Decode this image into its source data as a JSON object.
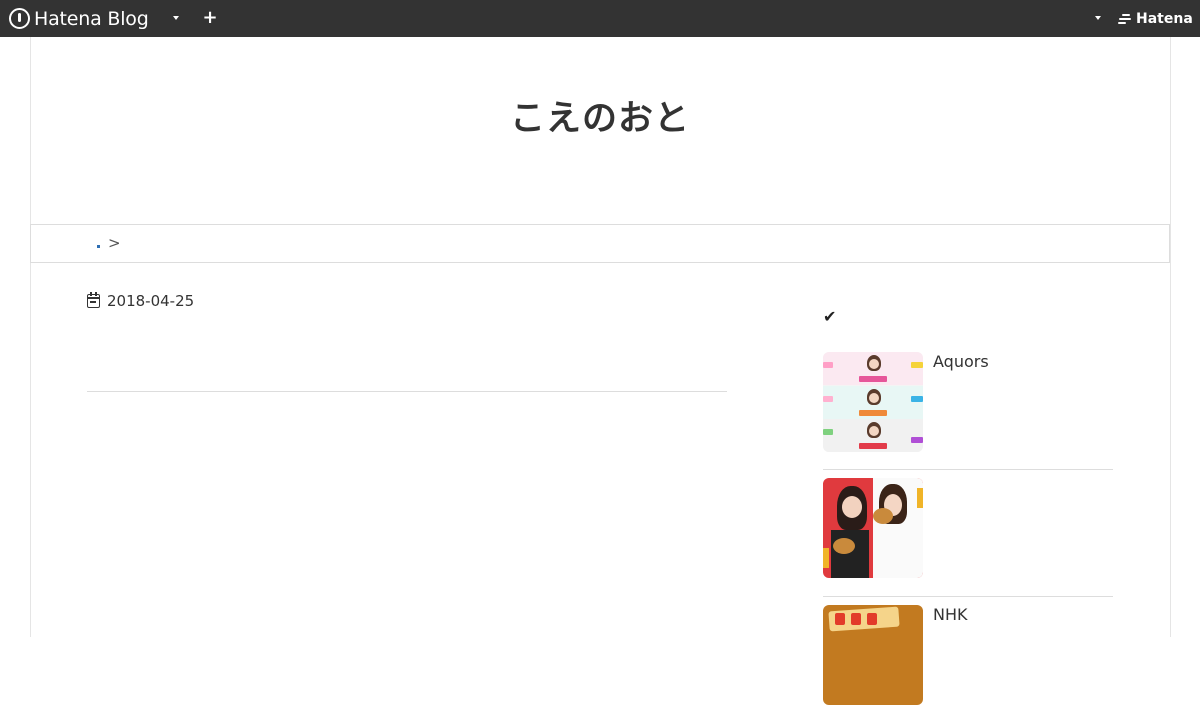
{
  "topbar": {
    "brand": "Hatena Blog",
    "right_brand": "Hatena"
  },
  "blog": {
    "title": "こえのおと"
  },
  "breadcrumb": {
    "separator": ">"
  },
  "entry": {
    "date": "2018-04-25"
  },
  "sidebar": {
    "items": [
      {
        "title": "Aquors"
      },
      {
        "title": ""
      },
      {
        "title": "NHK"
      }
    ]
  },
  "colors": {
    "topbar_bg": "#333333",
    "link": "#2e6fb3"
  }
}
